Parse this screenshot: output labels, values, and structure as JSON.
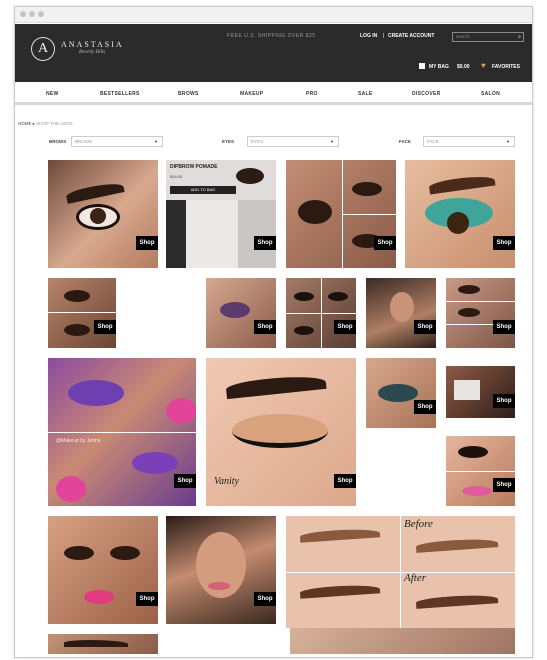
{
  "brand": {
    "name": "ANASTASIA",
    "tagline": "Beverly Hills",
    "monogram": "A"
  },
  "header": {
    "shipping": "FREE U.S. SHIPPING OVER $25",
    "login": "LOG IN",
    "separator": "|",
    "create_account": "CREATE ACCOUNT",
    "search_placeholder": "search",
    "bag_label": "MY BAG",
    "bag_total": "$0.00",
    "favorites_label": "FAVORITES",
    "colors": {
      "bar": "#2b2b2b",
      "heart": "#c9a85c"
    }
  },
  "nav": {
    "items": [
      "NEW",
      "BESTSELLERS",
      "BROWS",
      "MAKEUP",
      "PRO",
      "SALE",
      "DISCOVER",
      "SALON"
    ]
  },
  "breadcrumb": {
    "home": "HOME",
    "arrow": "▸",
    "current": "SHOP THE LOOK"
  },
  "filters": {
    "brows": {
      "label": "BROWS",
      "value": "BROWS"
    },
    "eyes": {
      "label": "EYES",
      "value": "EYES"
    },
    "face": {
      "label": "FACE",
      "value": "FACE"
    }
  },
  "tiles": {
    "shop_label": "Shop",
    "pomade": {
      "title": "DIPBROW POMADE",
      "price": "$18.00",
      "button": "ADD TO BAG"
    },
    "watermark": "@Makeup by Jenna",
    "signature": "Vanity",
    "before_label": "Before",
    "after_label": "After"
  }
}
